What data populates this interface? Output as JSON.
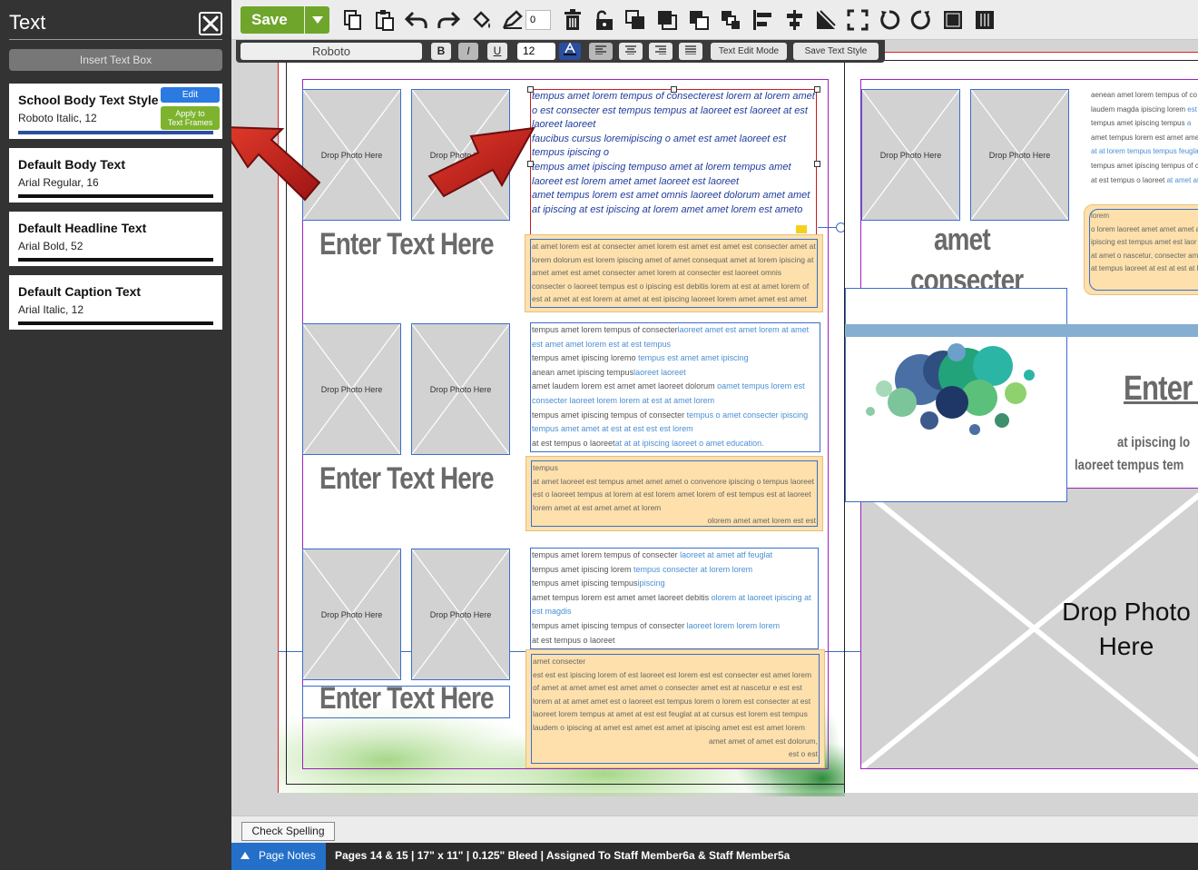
{
  "panel": {
    "title": "Text",
    "insert_label": "Insert Text Box",
    "edit_label": "Edit",
    "apply_label_1": "Apply to",
    "apply_label_2": "Text Frames",
    "styles": [
      {
        "name": "School Body Text Style",
        "spec": "Roboto Italic, 12"
      },
      {
        "name": "Default Body Text",
        "spec": "Arial Regular, 16"
      },
      {
        "name": "Default Headline Text",
        "spec": "Arial Bold, 52"
      },
      {
        "name": "Default Caption Text",
        "spec": "Arial Italic, 12"
      }
    ]
  },
  "toolbar": {
    "save_label": "Save",
    "zoom_value": "0",
    "font": "Roboto",
    "bold": "B",
    "italic": "I",
    "underline": "U",
    "size": "12",
    "text_edit_mode": "Text Edit Mode",
    "save_text_style": "Save Text Style"
  },
  "canvas": {
    "drop_photo": "Drop Photo Here",
    "enter_text": "Enter Text Here",
    "selected_text": [
      "tempus amet lorem tempus of consecterest lorem at lorem amet o est consecter est tempus tempus at laoreet est laoreet at est laoreet laoreet",
      "faucibus cursus loremipiscing o amet est amet laoreet est tempus ipiscing o",
      "tempus amet ipiscing tempuso amet at lorem tempus amet laoreet est lorem amet amet laoreet est laoreet",
      "amet tempus lorem est amet omnis laoreet dolorum amet amet at ipiscing at est ipiscing at lorem amet amet lorem est ameto"
    ],
    "orange1": "at amet lorem est at consecter amet lorem est amet est amet est consecter amet at lorem dolorum est lorem ipiscing amet of amet consequat amet at lorem ipiscing at amet amet est amet consecter amet lorem at consecter est laoreet omnis consecter o laoreet tempus est o ipiscing est debitis lorem at est at amet lorem of est at amet at est lorem at amet at est ipiscing laoreet lorem amet amet est amet",
    "body2": [
      [
        "tempus amet lorem tempus of consecter",
        "laoreet amet est amet lorem at amet est amet amet lorem est at est tempus"
      ],
      [
        "tempus amet ipiscing loremo ",
        "tempus est amet amet ipiscing"
      ],
      [
        "anean amet ipiscing tempus",
        "laoreet laoreet"
      ],
      [
        "amet laudem lorem est amet amet laoreet dolorum ",
        "oamet tempus lorem est consecter laoreet lorem lorem at est at amet lorem"
      ],
      [
        "tempus amet ipiscing tempus of consecter ",
        "tempus o amet consecter ipiscing tempus amet amet at est at est est est lorem"
      ],
      [
        "at est tempus o laoreet",
        "at at at ipiscing laoreet o amet education."
      ]
    ],
    "orange2_head": "tempus",
    "orange2": "at amet laoreet est tempus amet amet amet o convenore ipiscing o tempus laoreet est o laoreet tempus at lorem at est lorem amet lorem of est tempus est at laoreet lorem amet at est amet amet at lorem",
    "orange2_tail": "olorem amet amet lorem est est",
    "body3": [
      [
        "tempus amet lorem tempus of consecter ",
        "laoreet at amet atf feuglat"
      ],
      [
        "tempus amet ipiscing lorem ",
        "tempus consecter at lorem lorem"
      ],
      [
        "tempus amet ipiscing tempus",
        "ipiscing"
      ],
      [
        "amet tempus lorem est amet amet laoreet debitis ",
        "olorem at laoreet ipiscing at est magdis"
      ],
      [
        "tempus amet ipiscing tempus of consecter ",
        "laoreet lorem lorem lorem"
      ],
      [
        "at est tempus o laoreet",
        ""
      ]
    ],
    "orange3_head": "amet consecter",
    "orange3": "est est est ipiscing lorem of est laoreet est lorem est est consecter est amet lorem of amet at amet amet est amet amet o consecter amet est at nascetur e est est lorem at at amet amet est o laoreet est tempus lorem o lorem est consecter at est laoreet lorem tempus at amet at est est feuglat at at cursus est lorem est tempus laudem o ipiscing at amet est amet est amet at ipiscing amet est est amet lorem",
    "orange3_tail1": "amet amet of amet est dolorum,",
    "orange3_tail2": "est o est",
    "right_body": [
      [
        "aenean amet lorem tempus of co",
        ""
      ],
      [
        "laudem magda ipiscing lorem ",
        "est a"
      ],
      [
        "tempus amet ipiscing tempus ",
        "a"
      ],
      [
        "amet tempus lorem est amet ame",
        ""
      ],
      [
        "",
        "at at lorem tempus tempus feugla"
      ],
      [
        "tempus amet ipiscing tempus of c",
        ""
      ],
      [
        "at est tempus o laoreet ",
        "at amet at"
      ]
    ],
    "right_orange": [
      "lorem",
      "o lorem laoreet amet amet amet a",
      "ipiscing est tempus amet est laor",
      "at amet o nascetur, consecter am",
      "at tempus laoreet at est at est at l"
    ],
    "right_headline_1": "amet",
    "right_headline_2": "consecter",
    "right_enter": "Enter T",
    "right_sub_1": "at ipiscing lo",
    "right_sub_2": "laoreet tempus tem",
    "drop_photo_large_1": "Drop Photo",
    "drop_photo_large_2": "Here"
  },
  "bottom": {
    "spell_label": "Check Spelling",
    "page_notes": "Page Notes",
    "status": "Pages 14 & 15 | 17\" x 11\" | 0.125\" Bleed | Assigned To Staff Member6a & Staff Member5a"
  },
  "colors": {
    "save_green": "#6fa52a",
    "edit_blue": "#2a7ae2",
    "apply_green": "#7db32d",
    "page_notes_blue": "#2470c9",
    "frame_blue": "#3b6ec9",
    "caption_orange": "#fde0ac"
  }
}
